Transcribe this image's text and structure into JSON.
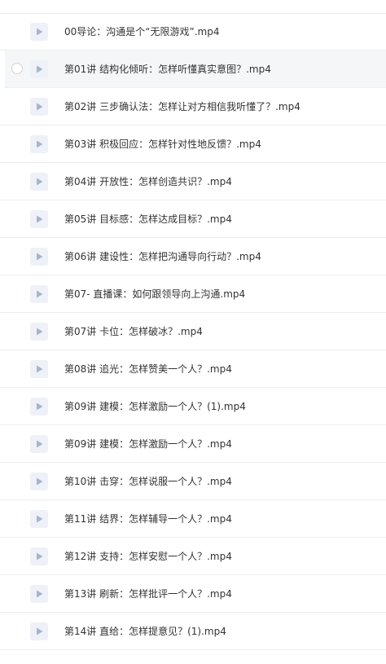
{
  "files": [
    {
      "name": "00导论：沟通是个“无限游戏”.mp4",
      "icon": "video-file-icon"
    },
    {
      "name": "第01讲 结构化倾听：怎样听懂真实意图？.mp4",
      "icon": "video-file-icon",
      "hover": true
    },
    {
      "name": "第02讲 三步确认法：怎样让对方相信我听懂了？.mp4",
      "icon": "video-file-icon"
    },
    {
      "name": "第03讲 积极回应：怎样针对性地反馈？.mp4",
      "icon": "video-file-icon"
    },
    {
      "name": "第04讲 开放性：怎样创造共识？.mp4",
      "icon": "video-file-icon"
    },
    {
      "name": "第05讲 目标感：怎样达成目标？.mp4",
      "icon": "video-file-icon"
    },
    {
      "name": "第06讲 建设性：怎样把沟通导向行动？.mp4",
      "icon": "video-file-icon"
    },
    {
      "name": "第07- 直播课：如何跟领导向上沟通.mp4",
      "icon": "video-file-icon"
    },
    {
      "name": "第07讲 卡位：怎样破冰？.mp4",
      "icon": "video-file-icon"
    },
    {
      "name": "第08讲 追光：怎样赞美一个人？.mp4",
      "icon": "video-file-icon"
    },
    {
      "name": "第09讲 建模：怎样激励一个人？(1).mp4",
      "icon": "video-file-icon"
    },
    {
      "name": "第09讲 建模：怎样激励一个人？.mp4",
      "icon": "video-file-icon"
    },
    {
      "name": "第10讲 击穿：怎样说服一个人？.mp4",
      "icon": "video-file-icon"
    },
    {
      "name": "第11讲 结界：怎样辅导一个人？.mp4",
      "icon": "video-file-icon"
    },
    {
      "name": "第12讲 支持：怎样安慰一个人？.mp4",
      "icon": "video-file-icon"
    },
    {
      "name": "第13讲 刷新：怎样批评一个人？.mp4",
      "icon": "video-file-icon"
    },
    {
      "name": "第14讲 直给：怎样提意见？(1).mp4",
      "icon": "video-file-icon"
    }
  ],
  "colors": {
    "hover_bg": "#f5f6f8",
    "icon_bg": "#eef1f7",
    "play": "#a9b4cc",
    "divider": "#eeeeee"
  }
}
